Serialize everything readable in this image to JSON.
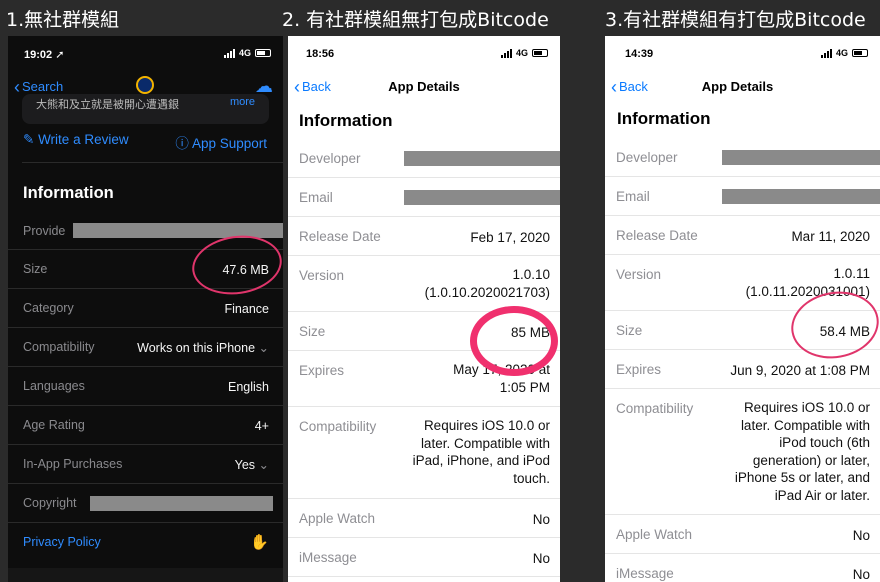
{
  "columns": [
    {
      "title": "1.無社群模組"
    },
    {
      "title": "2. 有社群模組無打包成Bitcode"
    },
    {
      "title": "3.有社群模組有打包成Bitcode"
    }
  ],
  "phone1": {
    "status": {
      "time": "19:02",
      "network": "4G"
    },
    "nav": {
      "back": "Search"
    },
    "snippet": "大熊和及立就是被開心遭遇銀",
    "more": "more",
    "write_review": "Write a Review",
    "app_support": "App Support",
    "section_title": "Information",
    "rows": [
      {
        "label": "Provide",
        "value": ""
      },
      {
        "label": "Size",
        "value": "47.6 MB"
      },
      {
        "label": "Category",
        "value": "Finance"
      },
      {
        "label": "Compatibility",
        "value": "Works on this iPhone"
      },
      {
        "label": "Languages",
        "value": "English"
      },
      {
        "label": "Age Rating",
        "value": "4+"
      },
      {
        "label": "In-App Purchases",
        "value": "Yes"
      },
      {
        "label": "Copyright",
        "value": ""
      }
    ],
    "privacy": "Privacy Policy"
  },
  "phone2": {
    "status": {
      "time": "18:56",
      "network": "4G"
    },
    "nav": {
      "back": "Back",
      "title": "App Details"
    },
    "section_title": "Information",
    "developer": "Developer",
    "email": "Email",
    "release_label": "Release Date",
    "release": "Feb 17, 2020",
    "version_label": "Version",
    "version": "1.0.10",
    "build": "(1.0.10.2020021703)",
    "size_label": "Size",
    "size": "85 MB",
    "expires_label": "Expires",
    "expires": "May 17, 2020 at",
    "expires_time": "1:05 PM",
    "compat_label": "Compatibility",
    "compat": "Requires iOS 10.0 or later. Compatible with iPad, iPhone, and iPod touch.",
    "watch_label": "Apple Watch",
    "watch": "No",
    "imessage_label": "iMessage",
    "imessage": "No"
  },
  "phone3": {
    "status": {
      "time": "14:39",
      "network": "4G"
    },
    "nav": {
      "back": "Back",
      "title": "App Details"
    },
    "section_title": "Information",
    "developer": "Developer",
    "email": "Email",
    "release_label": "Release Date",
    "release": "Mar 11, 2020",
    "version_label": "Version",
    "version": "1.0.11",
    "build": "(1.0.11.2020031001)",
    "size_label": "Size",
    "size": "58.4 MB",
    "expires_label": "Expires",
    "expires": "Jun 9, 2020 at 1:08 PM",
    "compat_label": "Compatibility",
    "compat": "Requires iOS 10.0 or later. Compatible with iPod touch (6th generation) or later, iPhone 5s or later, and iPad Air or later.",
    "watch_label": "Apple Watch",
    "watch": "No",
    "imessage_label": "iMessage",
    "imessage": "No"
  }
}
